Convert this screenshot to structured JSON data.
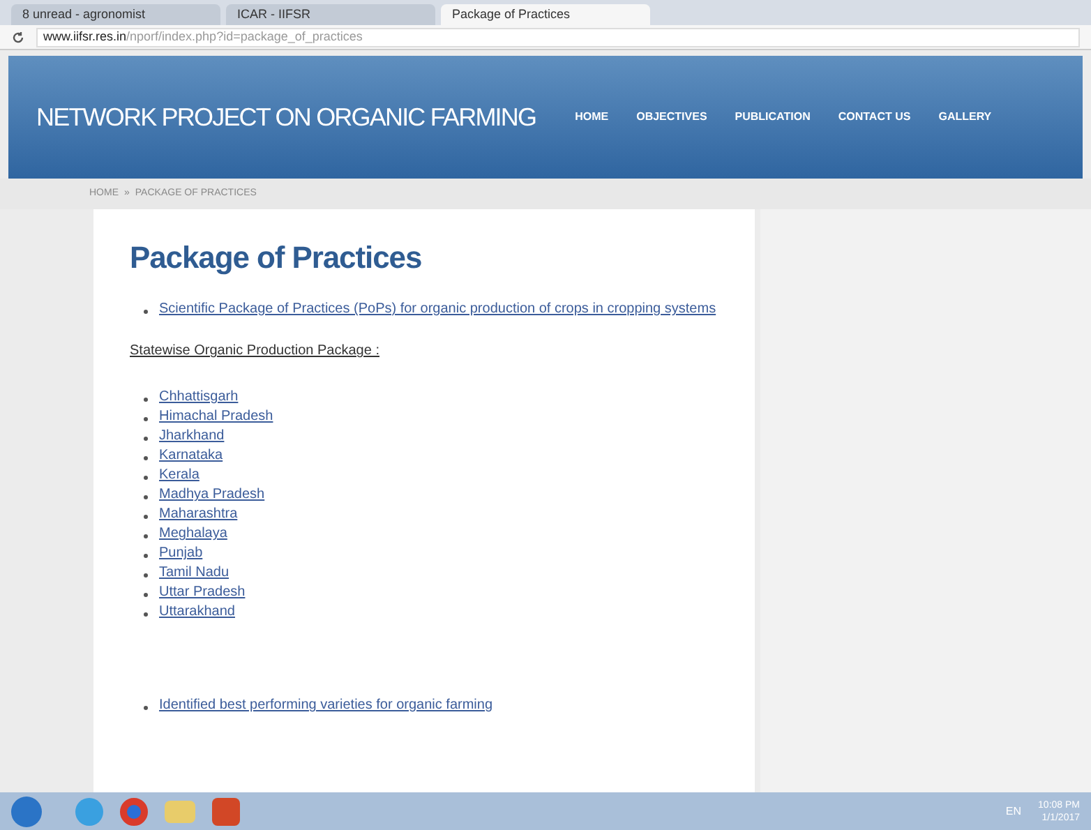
{
  "browser": {
    "tabs": [
      {
        "label": "8 unread - agronomist",
        "selected": false
      },
      {
        "label": "ICAR - IIFSR",
        "selected": false
      },
      {
        "label": "Package of Practices",
        "selected": true
      }
    ],
    "url_host": "www.iifsr.res.in",
    "url_path": "/nporf/index.php?id=package_of_practices"
  },
  "site": {
    "title": "NETWORK PROJECT ON ORGANIC FARMING",
    "nav": [
      "HOME",
      "OBJECTIVES",
      "PUBLICATION",
      "CONTACT US",
      "GALLERY"
    ],
    "breadcrumb": [
      "HOME",
      "»",
      "PACKAGE OF PRACTICES"
    ]
  },
  "content": {
    "heading": "Package of Practices",
    "top_link": "Scientific Package of Practices (PoPs) for organic production of crops in cropping systems",
    "subheading": "Statewise Organic Production Package :",
    "states": [
      "Chhattisgarh",
      "Himachal Pradesh",
      "Jharkhand",
      "Karnataka",
      "Kerala",
      "Madhya Pradesh",
      "Maharashtra",
      "Meghalaya",
      "Punjab",
      "Tamil Nadu",
      "Uttar Pradesh",
      "Uttarakhand"
    ],
    "bottom_link": "Identified best performing varieties for organic farming"
  },
  "taskbar": {
    "language": "EN",
    "time": "10:08 PM",
    "date": "1/1/2017"
  }
}
